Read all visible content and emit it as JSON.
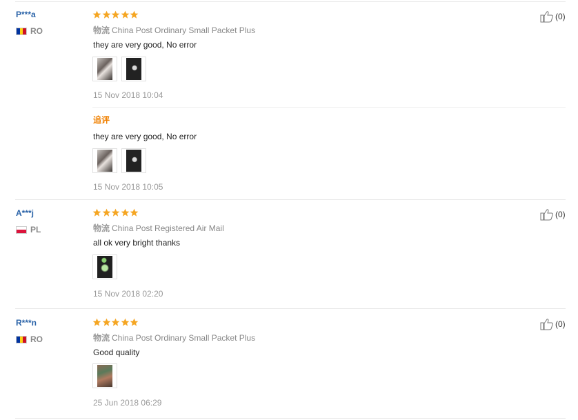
{
  "reviews": [
    {
      "user": "P***a",
      "country": "RO",
      "shipping_label": "物流",
      "shipping": "China Post Ordinary Small Packet Plus",
      "text": "they are very good, No error",
      "date": "15 Nov 2018 10:04",
      "likes": "(0)",
      "additional": {
        "label": "追评",
        "text": "they are very good, No error",
        "date": "15 Nov 2018 10:05"
      }
    },
    {
      "user": "A***j",
      "country": "PL",
      "shipping_label": "物流",
      "shipping": "China Post Registered Air Mail",
      "text": "all ok very bright thanks",
      "date": "15 Nov 2018 02:20",
      "likes": "(0)"
    },
    {
      "user": "R***n",
      "country": "RO",
      "shipping_label": "物流",
      "shipping": "China Post Ordinary Small Packet Plus",
      "text": "Good quality",
      "date": "25 Jun 2018 06:29",
      "likes": "(0)"
    }
  ],
  "colors": {
    "star": "#f5a623",
    "username": "#2a63a8",
    "additional_label": "#f08000"
  },
  "icons": {
    "star": "star-icon",
    "like": "thumbs-up-icon"
  }
}
